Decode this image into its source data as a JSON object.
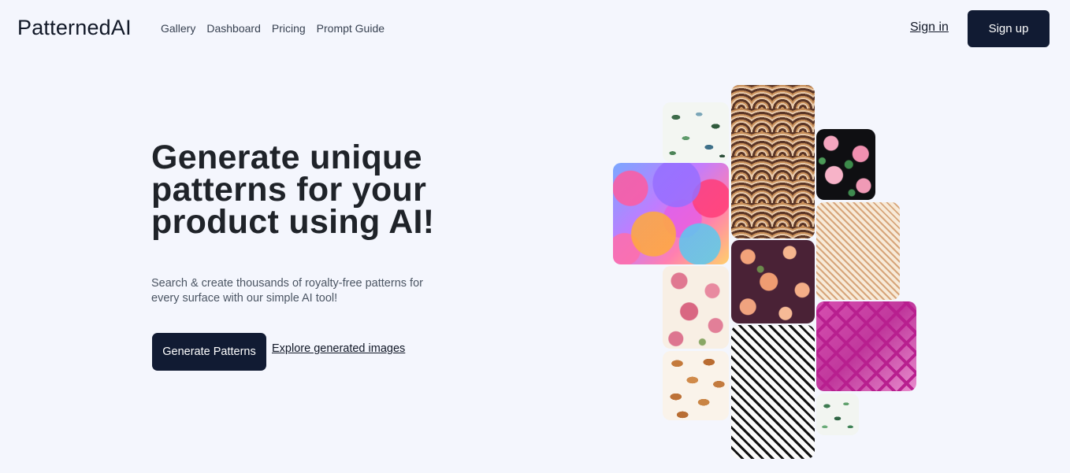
{
  "header": {
    "logo": "PatternedAI",
    "nav": [
      "Gallery",
      "Dashboard",
      "Pricing",
      "Prompt Guide"
    ],
    "sign_in": "Sign in",
    "sign_up": "Sign up"
  },
  "hero": {
    "title": "Generate unique patterns for your product using AI!",
    "subtitle": "Search & create thousands of royalty-free patterns for every surface with our simple AI tool!",
    "primary_button": "Generate Patterns",
    "secondary_link": "Explore generated images"
  },
  "gallery": {
    "tiles": [
      {
        "pattern": "watercolor-leaves"
      },
      {
        "pattern": "colorful-overlapping-circles"
      },
      {
        "pattern": "art-deco-fans"
      },
      {
        "pattern": "pink-roses-on-black"
      },
      {
        "pattern": "gold-concentric-diamonds"
      },
      {
        "pattern": "peach-florals-on-plum"
      },
      {
        "pattern": "pink-roses-on-cream"
      },
      {
        "pattern": "magenta-lattice"
      },
      {
        "pattern": "black-white-concentric-diamonds"
      },
      {
        "pattern": "pastries"
      },
      {
        "pattern": "green-leaves"
      }
    ]
  },
  "colors": {
    "background": "#f4f6fd",
    "primary_button": "#111b33",
    "text_dark": "#1f2329",
    "text_muted": "#4b5563"
  }
}
